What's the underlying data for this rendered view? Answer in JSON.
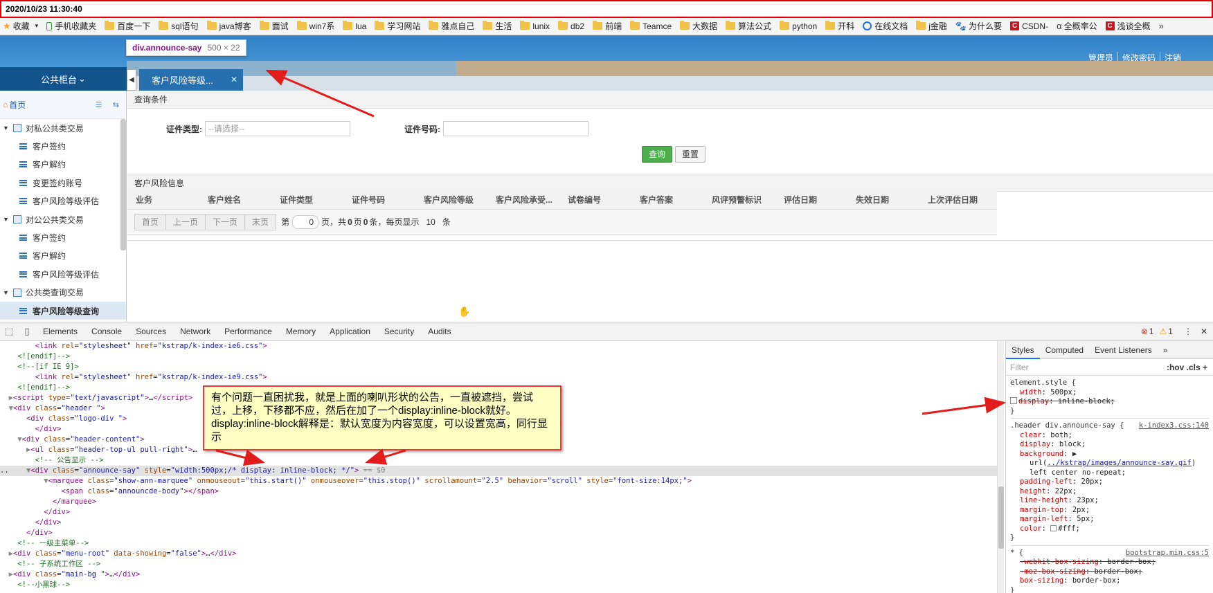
{
  "timestamp": "2020/10/23 11:30:40",
  "bookmarks": [
    "收藏",
    "手机收藏夹",
    "百度一下",
    "sql语句",
    "java博客",
    "面试",
    "win7系",
    "lua",
    "学习网站",
    "雅点自己",
    "生活",
    "lunix",
    "db2",
    "前端",
    "Teamce",
    "大数据",
    "算法公式",
    "python",
    "开科",
    "在线文档",
    "j金融",
    "为什么要",
    "CSDN-",
    "全概率公",
    "浅谈全概",
    "»"
  ],
  "header_links": [
    "管理员",
    "修改密码",
    "注销"
  ],
  "tooltip": {
    "tag": "div.announce-say",
    "size": "500 × 22"
  },
  "left_top": "公共柜台",
  "active_tab": "客户风险等级...",
  "sidebar": {
    "home": "首页",
    "items": [
      {
        "type": "group",
        "label": "对私公共类交易"
      },
      {
        "type": "child",
        "label": "客户签约"
      },
      {
        "type": "child",
        "label": "客户解约"
      },
      {
        "type": "child",
        "label": "变更签约账号"
      },
      {
        "type": "child",
        "label": "客户风险等级评估"
      },
      {
        "type": "group",
        "label": "对公公共类交易"
      },
      {
        "type": "child",
        "label": "客户签约"
      },
      {
        "type": "child",
        "label": "客户解约"
      },
      {
        "type": "child",
        "label": "客户风险等级评估"
      },
      {
        "type": "group",
        "label": "公共类查询交易"
      },
      {
        "type": "child",
        "label": "客户风险等级查询",
        "active": true
      }
    ]
  },
  "query": {
    "title": "查询条件",
    "id_type_label": "证件类型:",
    "id_type_placeholder": "--请选择--",
    "id_no_label": "证件号码:",
    "search_btn": "查询",
    "reset_btn": "重置"
  },
  "table": {
    "title": "客户风险信息",
    "columns": [
      "业务",
      "客户姓名",
      "证件类型",
      "证件号码",
      "客户风险等级",
      "客户风险承受...",
      "试卷编号",
      "客户答案",
      "风评预警标识",
      "评估日期",
      "失效日期",
      "上次评估日期"
    ]
  },
  "pager": {
    "first": "首页",
    "prev": "上一页",
    "next": "下一页",
    "last": "末页",
    "page_prefix": "第",
    "page": "0",
    "page_suffix": "页，共",
    "total_pages": "0",
    "mid": "页",
    "total_items": "0",
    "per_page_label": "条，每页显示",
    "per_page": "10",
    "unit": "条"
  },
  "devtools": {
    "tabs": [
      "Elements",
      "Console",
      "Sources",
      "Network",
      "Performance",
      "Memory",
      "Application",
      "Security",
      "Audits"
    ],
    "errors": "1",
    "warnings": "1",
    "styles_tabs": [
      "Styles",
      "Computed",
      "Event Listeners",
      "»"
    ],
    "filter_placeholder": "Filter",
    "filter_opts": ":hov  .cls  +"
  },
  "annotation": "有个问题一直困扰我，就是上面的喇叭形状的公告，一直被遮挡，尝试过，上移，下移都不应，然后在加了一个display:inline-block就好。display:inline-block解释是：默认宽度为内容宽度，可以设置宽高，同行显示"
}
